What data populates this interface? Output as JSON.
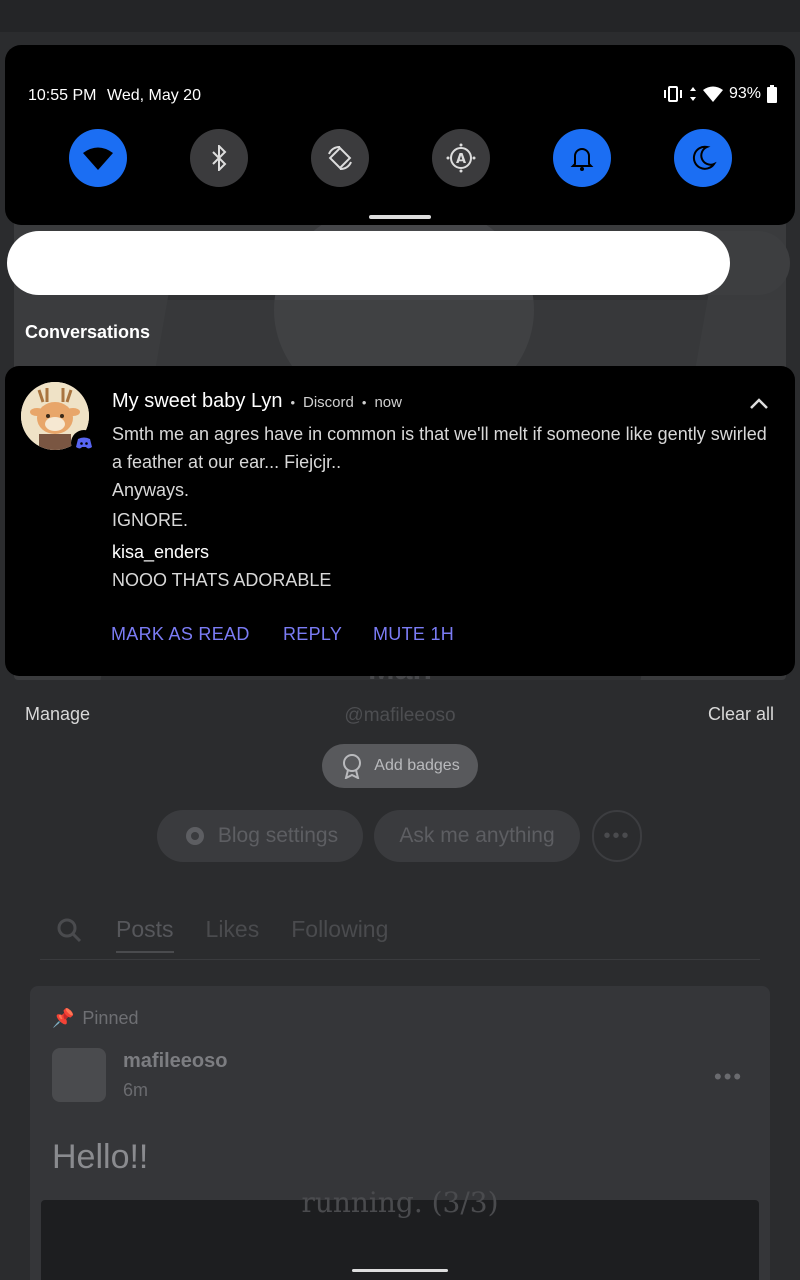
{
  "status_bar": {
    "time": "10:55 PM",
    "date": "Wed, May 20",
    "battery": "93%"
  },
  "quick_tiles": [
    {
      "name": "wifi",
      "state": "on"
    },
    {
      "name": "bluetooth",
      "state": "off"
    },
    {
      "name": "auto-rotate",
      "state": "off"
    },
    {
      "name": "auto-brightness",
      "state": "off"
    },
    {
      "name": "notifications",
      "state": "on"
    },
    {
      "name": "night-mode",
      "state": "on"
    }
  ],
  "colors": {
    "tile_on": "#1b6ef3",
    "tile_off": "#3b3b3d",
    "action": "#7b7cf5",
    "discord": "#5865f2"
  },
  "section_label": "Conversations",
  "notification": {
    "sender": "My sweet baby Lyn",
    "app": "Discord",
    "time": "now",
    "message_1": "Smth me an agres have in common is that we'll melt if someone like gently swirled a feather at our ear... Fiejcjr..",
    "message_2": "Anyways.",
    "message_3": "IGNORE.",
    "reply_user": "kisa_enders",
    "reply_text": "NOOO THATS ADORABLE",
    "actions": [
      "MARK AS READ",
      "REPLY",
      "MUTE 1H"
    ]
  },
  "footer": {
    "manage": "Manage",
    "clear_all": "Clear all"
  },
  "background_blog": {
    "title": "Man",
    "handle": "@mafileeoso",
    "add_badges": "Add badges",
    "blog_settings": "Blog settings",
    "ask_me": "Ask me anything",
    "tabs": [
      "Posts",
      "Likes",
      "Following"
    ],
    "pinned": "Pinned",
    "author": "mafileeoso",
    "post_time": "6m",
    "post_body": "Hello!!",
    "image_text": "running. (3/3)"
  }
}
